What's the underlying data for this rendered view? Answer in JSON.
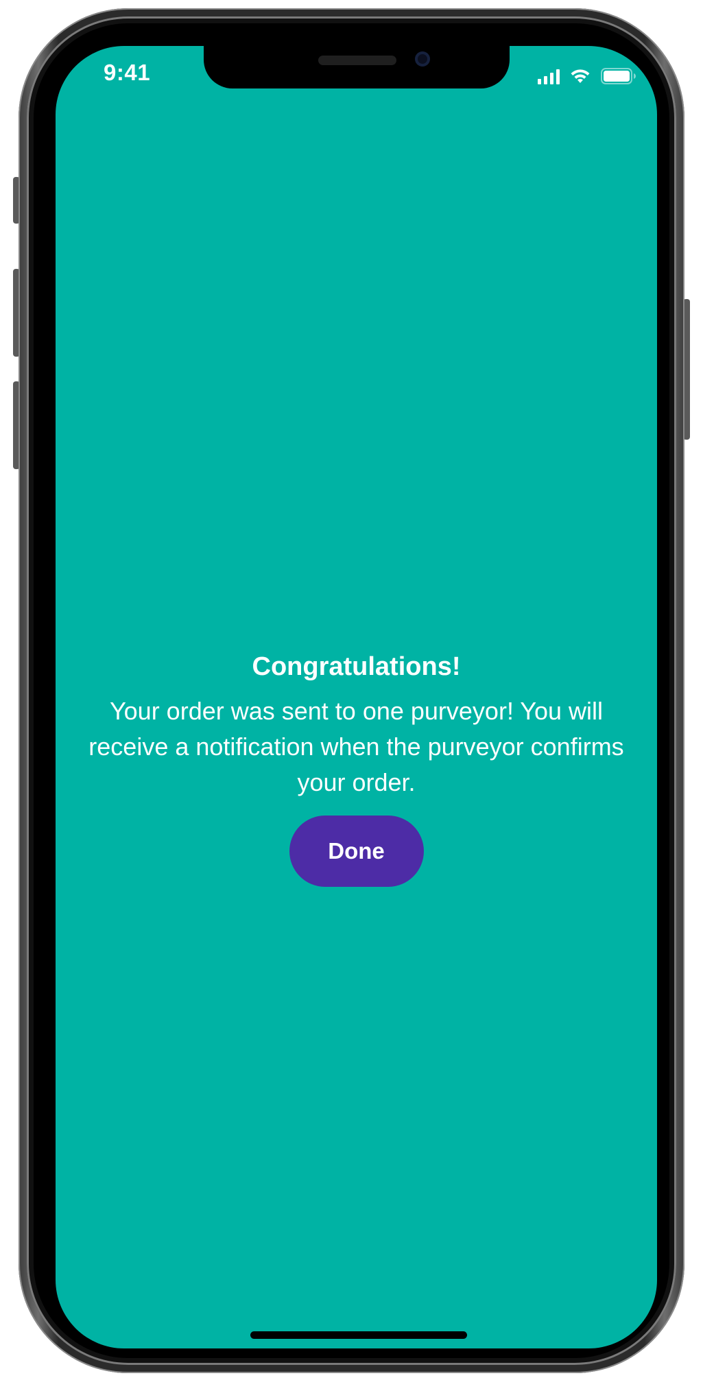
{
  "status_bar": {
    "time": "9:41",
    "icons": [
      "cellular-signal-icon",
      "wifi-icon",
      "battery-icon"
    ]
  },
  "confirmation": {
    "title": "Congratulations!",
    "message": "Your order was sent to one purveyor! You will receive a notification when the purveyor confirms your order.",
    "done_label": "Done"
  },
  "colors": {
    "background": "#00b3a4",
    "button": "#4d2ca6",
    "text": "#ffffff"
  }
}
